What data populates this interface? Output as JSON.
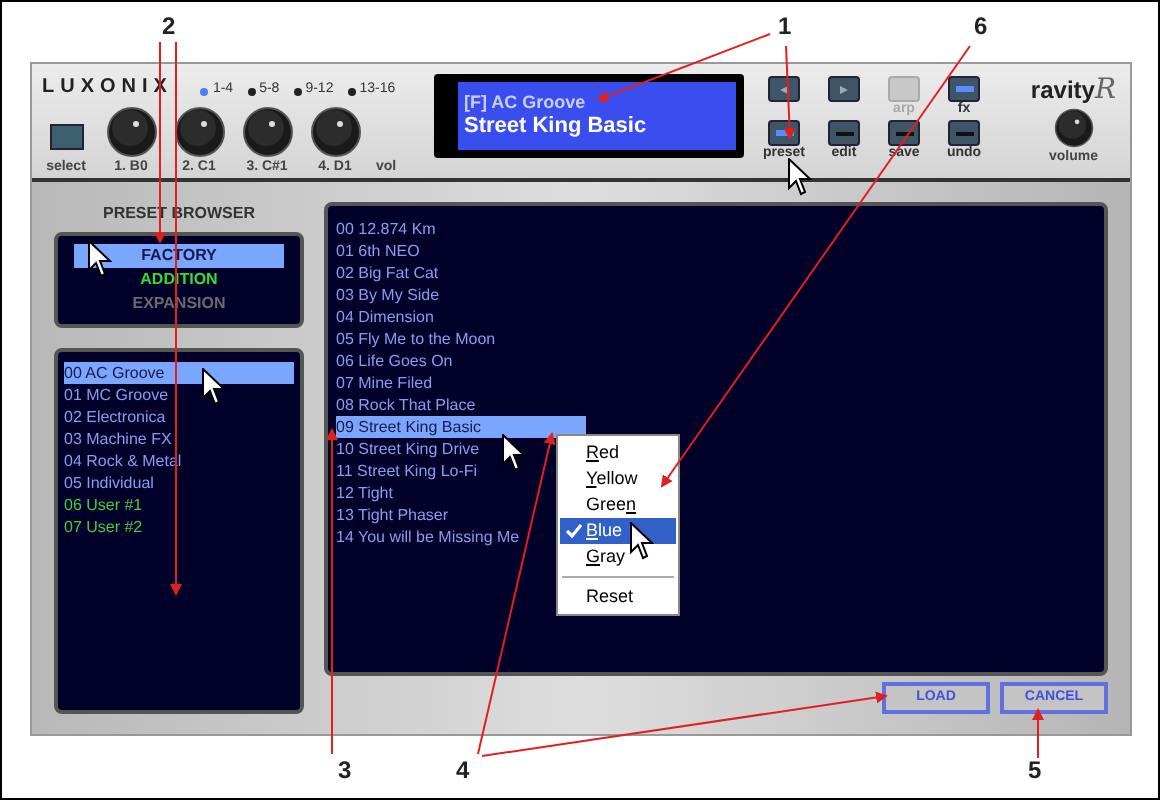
{
  "callouts": [
    {
      "label": "2"
    },
    {
      "label": "1"
    },
    {
      "label": "6"
    },
    {
      "label": "3"
    },
    {
      "label": "4"
    },
    {
      "label": "5"
    }
  ],
  "header": {
    "logo": "LUXONIX",
    "groups": [
      {
        "label": "1-4",
        "selected": true
      },
      {
        "label": "5-8",
        "selected": false
      },
      {
        "label": "9-12",
        "selected": false
      },
      {
        "label": "13-16",
        "selected": false
      }
    ],
    "select_label": "select",
    "knobs": [
      {
        "label": "1. B0"
      },
      {
        "label": "2. C1"
      },
      {
        "label": "3. C#1"
      },
      {
        "label": "4. D1"
      }
    ],
    "vol_label": "vol",
    "display": {
      "line1": "[F] AC Groove",
      "line2": "Street King Basic"
    },
    "transport": [
      {
        "kind": "prev"
      },
      {
        "kind": "next"
      }
    ],
    "top_buttons": [
      {
        "label": "arp",
        "on": false,
        "disabled": true
      },
      {
        "label": "fx",
        "on": true,
        "disabled": false
      }
    ],
    "bottom_buttons": [
      {
        "label": "preset",
        "on": true,
        "disabled": false
      },
      {
        "label": "edit",
        "on": false,
        "disabled": false
      },
      {
        "label": "save",
        "on": false,
        "disabled": false
      },
      {
        "label": "undo",
        "on": false,
        "disabled": false
      }
    ],
    "brand": "ravity",
    "brand_mark": "R",
    "volume_label": "volume"
  },
  "browser": {
    "title": "PRESET BROWSER",
    "banks": [
      {
        "label": "FACTORY",
        "selected": true,
        "disabled": false
      },
      {
        "label": "ADDITION",
        "selected": false,
        "disabled": false
      },
      {
        "label": "EXPANSION",
        "selected": false,
        "disabled": true
      }
    ],
    "programs": [
      {
        "label": "00 AC Groove",
        "selected": true,
        "kind": "preset"
      },
      {
        "label": "01 MC Groove",
        "selected": false,
        "kind": "preset"
      },
      {
        "label": "02 Electronica",
        "selected": false,
        "kind": "preset"
      },
      {
        "label": "03 Machine FX",
        "selected": false,
        "kind": "preset"
      },
      {
        "label": "04 Rock & Metal",
        "selected": false,
        "kind": "preset"
      },
      {
        "label": "05 Individual",
        "selected": false,
        "kind": "preset"
      },
      {
        "label": "06 User #1",
        "selected": false,
        "kind": "user"
      },
      {
        "label": "07 User #2",
        "selected": false,
        "kind": "user"
      }
    ],
    "patches": [
      {
        "label": "00 12.874 Km",
        "selected": false
      },
      {
        "label": "01 6th NEO",
        "selected": false
      },
      {
        "label": "02 Big Fat Cat",
        "selected": false
      },
      {
        "label": "03 By My Side",
        "selected": false
      },
      {
        "label": "04 Dimension",
        "selected": false
      },
      {
        "label": "05 Fly Me to the Moon",
        "selected": false
      },
      {
        "label": "06 Life Goes On",
        "selected": false
      },
      {
        "label": "07 Mine Filed",
        "selected": false
      },
      {
        "label": "08 Rock That Place",
        "selected": false
      },
      {
        "label": "09 Street King Basic",
        "selected": true
      },
      {
        "label": "10 Street King Drive",
        "selected": false
      },
      {
        "label": "11 Street King Lo-Fi",
        "selected": false
      },
      {
        "label": "12 Tight",
        "selected": false
      },
      {
        "label": "13 Tight Phaser",
        "selected": false
      },
      {
        "label": "14 You will be Missing Me",
        "selected": false
      }
    ],
    "context_menu": [
      {
        "kind": "item",
        "key": "R",
        "after": "ed",
        "checked": false,
        "selected": false
      },
      {
        "kind": "item",
        "key": "Y",
        "after": "ellow",
        "checked": false,
        "selected": false
      },
      {
        "kind": "item",
        "before": "Gree",
        "key": "n",
        "checked": false,
        "selected": false
      },
      {
        "kind": "item",
        "key": "B",
        "after": "lue",
        "checked": true,
        "selected": true
      },
      {
        "kind": "item",
        "key": "G",
        "after": "ray",
        "checked": false,
        "selected": false
      },
      {
        "kind": "separator"
      },
      {
        "kind": "item",
        "before": "Reset",
        "checked": false,
        "selected": false
      }
    ],
    "buttons": [
      {
        "label": "LOAD"
      },
      {
        "label": "CANCEL"
      }
    ]
  }
}
